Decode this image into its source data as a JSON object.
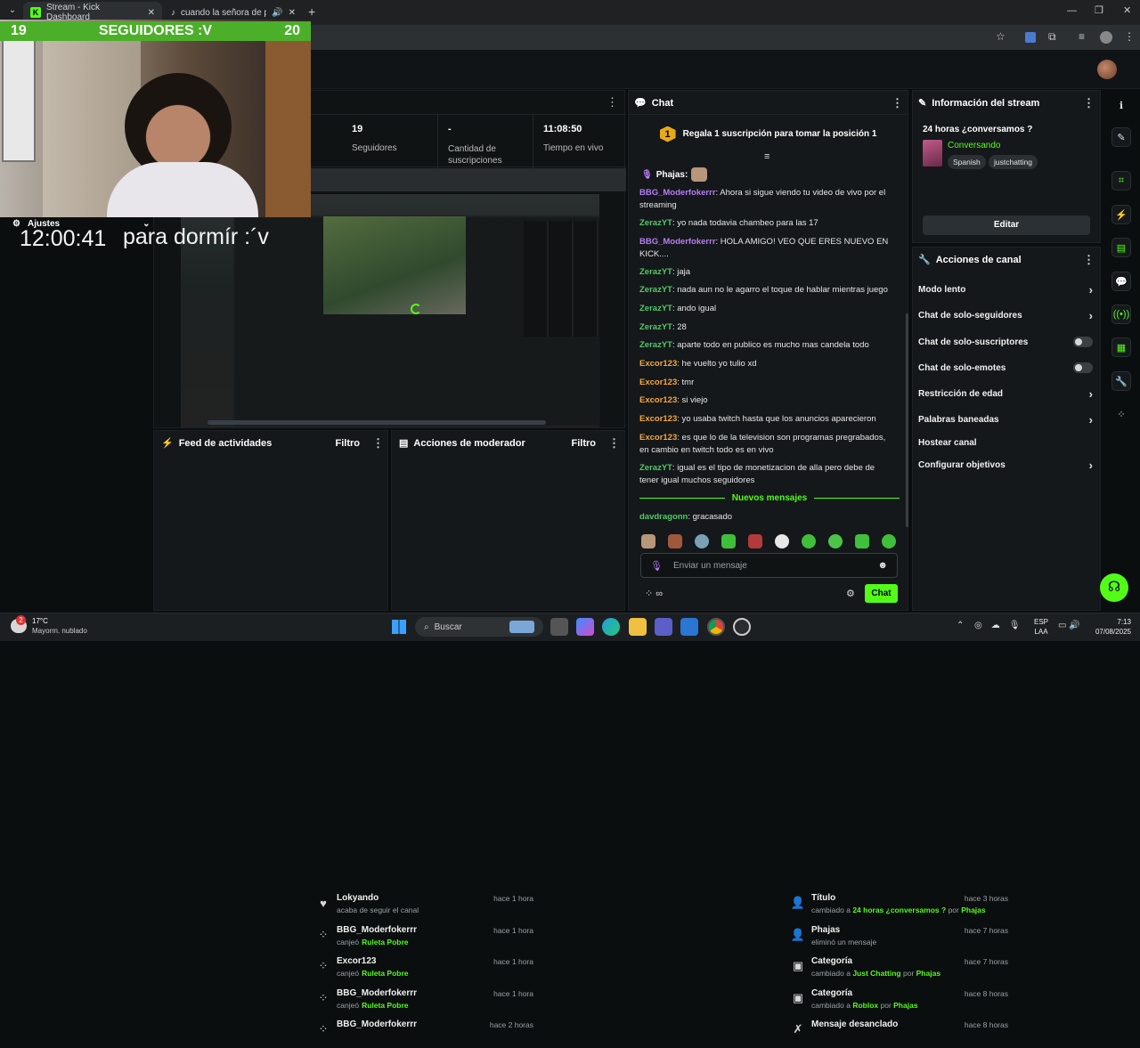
{
  "browser": {
    "tab1_title": "Stream - Kick Dashboard",
    "tab2_title": "cuando la señora de primar",
    "new_tab": "+"
  },
  "overlay": {
    "count_left": "19",
    "banner": "SEGUIDORES :V",
    "count_right": "20",
    "settings_label": "Ajustes",
    "clock": "12:00:41",
    "stream_title_overlay": "para dormír :´v"
  },
  "stats": {
    "followers_value": "19",
    "followers_label": "Seguidores",
    "subs_value": "-",
    "subs_label": "Cantidad de suscripciones",
    "live_value": "11:08:50",
    "live_label": "Tiempo en vivo"
  },
  "activity": {
    "title": "Feed de actividades",
    "filter": "Filtro",
    "items": [
      {
        "name": "Lokyando",
        "sub": "acaba de seguir el canal",
        "reward": "",
        "time": "hace 1 hora",
        "icon": "heart-icon"
      },
      {
        "name": "BBG_Moderfokerrr",
        "sub": "canjeó",
        "reward": "Ruleta Pobre",
        "time": "hace 1 hora",
        "icon": "points-icon"
      },
      {
        "name": "Excor123",
        "sub": "canjeó",
        "reward": "Ruleta Pobre",
        "time": "hace 1 hora",
        "icon": "points-icon"
      },
      {
        "name": "BBG_Moderfokerrr",
        "sub": "canjeó",
        "reward": "Ruleta Pobre",
        "time": "hace 1 hora",
        "icon": "points-icon"
      },
      {
        "name": "BBG_Moderfokerrr",
        "sub": "",
        "reward": "",
        "time": "hace 2 horas",
        "icon": "points-icon"
      }
    ]
  },
  "modactions": {
    "title": "Acciones de moderador",
    "filter": "Filtro",
    "items": [
      {
        "title": "Título",
        "pre": "cambiado a ",
        "hl": "24 horas ¿conversamos ?",
        "mid": " por ",
        "by": "Phajas",
        "time": "hace 3 horas"
      },
      {
        "title": "Phajas",
        "pre": "eliminó un mensaje",
        "hl": "",
        "mid": "",
        "by": "",
        "time": "hace 7 horas"
      },
      {
        "title": "Categoría",
        "pre": "cambiado a ",
        "hl": "Just Chatting",
        "mid": " por ",
        "by": "Phajas",
        "time": "hace 7 horas"
      },
      {
        "title": "Categoría",
        "pre": "cambiado a ",
        "hl": "Roblox",
        "mid": " por ",
        "by": "Phajas",
        "time": "hace 8 horas"
      },
      {
        "title": "Mensaje desanclado",
        "pre": "",
        "hl": "",
        "mid": "",
        "by": "",
        "time": "hace 8 horas"
      }
    ]
  },
  "chat": {
    "title": "Chat",
    "gift_rank": "1",
    "gift_text": "Regala 1 suscripción para tomar la posición 1",
    "pinned_user": "Phajas:",
    "messages": [
      {
        "user": "BBG_Moderfokerrr",
        "text": ": Ahora si sigue viendo tu video de vivo por el streaming",
        "color": "purple"
      },
      {
        "user": "ZerazYT",
        "text": ": yo nada todavia chambeo para las 17",
        "color": "green"
      },
      {
        "user": "BBG_Moderfokerrr",
        "text": ": HOLA AMIGO! VEO QUE ERES NUEVO EN KICK....",
        "color": "purple"
      },
      {
        "user": "ZerazYT",
        "text": ": jaja",
        "color": "green"
      },
      {
        "user": "ZerazYT",
        "text": ": nada aun no le agarro el toque de hablar mientras juego",
        "color": "green"
      },
      {
        "user": "ZerazYT",
        "text": ": ando igual",
        "color": "green"
      },
      {
        "user": "ZerazYT",
        "text": ": 28",
        "color": "green"
      },
      {
        "user": "ZerazYT",
        "text": ": aparte todo en publico es mucho mas candela todo",
        "color": "green"
      },
      {
        "user": "Excor123",
        "text": ": he vuelto yo tulio xd",
        "color": "orange"
      },
      {
        "user": "Excor123",
        "text": ": tmr",
        "color": "orange"
      },
      {
        "user": "Excor123",
        "text": ": si viejo",
        "color": "orange"
      },
      {
        "user": "Excor123",
        "text": ": yo usaba twitch hasta que los anuncios aparecieron",
        "color": "orange"
      },
      {
        "user": "Excor123",
        "text": ": es que lo de la television son programas pregrabados, en cambio en twitch todo es en vivo",
        "color": "orange"
      },
      {
        "user": "ZerazYT",
        "text": ": igual es el tipo de monetizacion de alla pero debe de tener igual muchos seguidores",
        "color": "green"
      }
    ],
    "new_messages": "Nuevos mensajes",
    "last_user": "davdragonn",
    "last_text": ": gracasado",
    "input_placeholder": "Enviar un mensaje",
    "send": "Chat"
  },
  "info": {
    "title": "Información del stream",
    "stream_title": "24 horas ¿conversamos ?",
    "category": "Conversando",
    "tag1": "Spanish",
    "tag2": "justchatting",
    "edit": "Editar"
  },
  "actions": {
    "title": "Acciones de canal",
    "items": [
      {
        "label": "Modo lento",
        "kind": "chev"
      },
      {
        "label": "Chat de solo-seguidores",
        "kind": "chev"
      },
      {
        "label": "Chat de solo-suscriptores",
        "kind": "toggle"
      },
      {
        "label": "Chat de solo-emotes",
        "kind": "toggle"
      },
      {
        "label": "Restricción de edad",
        "kind": "chev"
      },
      {
        "label": "Palabras baneadas",
        "kind": "chev"
      },
      {
        "label": "Hostear canal",
        "kind": "none"
      },
      {
        "label": "Configurar objetivos",
        "kind": "chev"
      }
    ]
  },
  "taskbar": {
    "temp": "17°C",
    "weather": "Mayorm. nublado",
    "weather_badge": "2",
    "search": "Buscar",
    "lang1": "ESP",
    "lang2": "LAA",
    "time": "7:13",
    "date": "07/08/2025"
  },
  "colors": {
    "kick_green": "#53fc18",
    "panel": "#15181a",
    "bg": "#0b0e0f"
  }
}
